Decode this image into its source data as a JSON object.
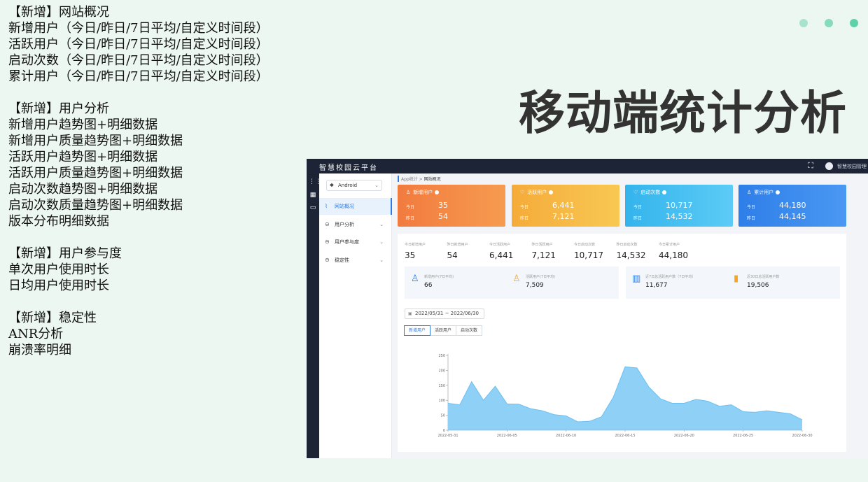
{
  "notes": [
    "【新增】网站概况",
    "新增用户（今日/昨日/7日平均/自定义时间段）",
    "活跃用户（今日/昨日/7日平均/自定义时间段）",
    "启动次数（今日/昨日/7日平均/自定义时间段）",
    "累计用户（今日/昨日/7日平均/自定义时间段）",
    "",
    "【新增】用户分析",
    "新增用户趋势图+明细数据",
    "新增用户质量趋势图+明细数据",
    "活跃用户趋势图+明细数据",
    "活跃用户质量趋势图+明细数据",
    " 启动次数趋势图+明细数据",
    "启动次数质量趋势图+明细数据",
    "版本分布明细数据",
    "",
    "【新增】用户参与度",
    "单次用户使用时长",
    "日均用户使用时长",
    "",
    "【新增】稳定性",
    " ANR分析",
    "崩溃率明细"
  ],
  "slide_title": "移动端统计分析",
  "dot_colors": [
    "#a8e3cd",
    "#86dbbc",
    "#5fd1a8"
  ],
  "app": {
    "brand": "智慧校园云平台",
    "fullscreen_icon": "fullscreen-icon",
    "user_name": "智慧校园管理",
    "platform_select": "Android",
    "menu": [
      {
        "label": "网站概况",
        "icon": "chart-icon",
        "active": true
      },
      {
        "label": "用户分析",
        "icon": "user-analysis-icon",
        "active": false
      },
      {
        "label": "用户参与度",
        "icon": "engagement-icon",
        "active": false
      },
      {
        "label": "稳定性",
        "icon": "stability-icon",
        "active": false
      }
    ],
    "breadcrumb": {
      "parent": "App统计",
      "sep": " > ",
      "current": "网站概况"
    },
    "cards": [
      {
        "title": "新增用户",
        "today_label": "今日",
        "today": "35",
        "yesterday_label": "昨日",
        "yesterday": "54",
        "color_from": "#f27b3f",
        "color_to": "#f69b4f"
      },
      {
        "title": "活跃用户",
        "today_label": "今日",
        "today": "6,441",
        "yesterday_label": "昨日",
        "yesterday": "7,121",
        "color_from": "#f5ab3a",
        "color_to": "#f8c853"
      },
      {
        "title": "启动次数",
        "today_label": "今日",
        "today": "10,717",
        "yesterday_label": "昨日",
        "yesterday": "14,532",
        "color_from": "#34b4ec",
        "color_to": "#5ccbf6"
      },
      {
        "title": "累计用户",
        "today_label": "今日",
        "today": "44,180",
        "yesterday_label": "昨日",
        "yesterday": "44,145",
        "color_from": "#2e7ee9",
        "color_to": "#4a98f2"
      }
    ],
    "kpis": [
      {
        "label": "今日新增用户",
        "value": "35"
      },
      {
        "label": "昨日新增用户",
        "value": "54"
      },
      {
        "label": "今日活跃用户",
        "value": "6,441"
      },
      {
        "label": "昨日活跃用户",
        "value": "7,121"
      },
      {
        "label": "今日启动次数",
        "value": "10,717"
      },
      {
        "label": "昨日启动次数",
        "value": "14,532"
      },
      {
        "label": "今日累计用户",
        "value": "44,180"
      }
    ],
    "user_boxes": [
      {
        "label": "新增用户(7日平均)",
        "value": "66",
        "icon": "user-add-icon",
        "color": "#2d7be3"
      },
      {
        "label": "活跃用户(7日平均)",
        "value": "7,509",
        "icon": "user-active-icon",
        "color": "#f5a623"
      },
      {
        "label": "近7日总活跃用户数（7日平均）",
        "value": "11,677",
        "icon": "bar-chart-icon",
        "color": "#2d7be3"
      },
      {
        "label": "近30日总活跃用户数",
        "value": "19,506",
        "icon": "column-chart-icon",
        "color": "#f5a623"
      }
    ],
    "date_range": "2022/05/31  ~ 2022/06/30",
    "tabs": [
      "新增用户",
      "活跃用户",
      "启动次数"
    ]
  },
  "chart_data": {
    "type": "area",
    "x": [
      "2022-05-31",
      "2022-06-01",
      "2022-06-02",
      "2022-06-03",
      "2022-06-04",
      "2022-06-05",
      "2022-06-06",
      "2022-06-07",
      "2022-06-08",
      "2022-06-09",
      "2022-06-10",
      "2022-06-11",
      "2022-06-12",
      "2022-06-13",
      "2022-06-14",
      "2022-06-15",
      "2022-06-16",
      "2022-06-17",
      "2022-06-18",
      "2022-06-19",
      "2022-06-20",
      "2022-06-21",
      "2022-06-22",
      "2022-06-23",
      "2022-06-24",
      "2022-06-25",
      "2022-06-26",
      "2022-06-27",
      "2022-06-28",
      "2022-06-29",
      "2022-06-30"
    ],
    "xticks": [
      "2022-05-31",
      "2022-06-05",
      "2022-06-10",
      "2022-06-15",
      "2022-06-20",
      "2022-06-25",
      "2022-06-30"
    ],
    "values": [
      90,
      85,
      162,
      100,
      147,
      88,
      87,
      72,
      65,
      52,
      48,
      28,
      30,
      45,
      110,
      212,
      208,
      145,
      105,
      90,
      90,
      103,
      97,
      80,
      85,
      62,
      60,
      65,
      60,
      55,
      35
    ],
    "yticks": [
      0,
      50,
      100,
      150,
      200,
      250
    ],
    "ylim": [
      0,
      250
    ],
    "fill": "#8fd0f7",
    "line": "#6cbff0"
  }
}
